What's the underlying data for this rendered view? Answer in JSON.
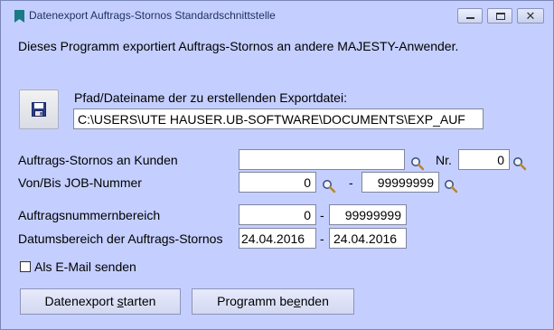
{
  "window": {
    "title": "Datenexport Auftrags-Stornos Standardschnittstelle",
    "minimize_glyph": "",
    "close_glyph": "✕"
  },
  "intro_text": "Dieses Programm exportiert Auftrags-Stornos an andere MAJESTY-Anwender.",
  "export_file": {
    "label": "Pfad/Dateiname der zu erstellenden Exportdatei:",
    "value": "C:\\USERS\\UTE HAUSER.UB-SOFTWARE\\DOCUMENTS\\EXP_AUF"
  },
  "customer": {
    "label": "Auftrags-Stornos an Kunden",
    "value": "",
    "nr_label": "Nr.",
    "nr_value": "0"
  },
  "job": {
    "label": "Von/Bis JOB-Nummer",
    "from": "0",
    "separator": "-",
    "to": "99999999"
  },
  "order_range": {
    "label": "Auftragsnummernbereich",
    "from": "0",
    "separator": "-",
    "to": "99999999"
  },
  "date_range": {
    "label": "Datumsbereich der Auftrags-Stornos",
    "from": "24.04.2016",
    "separator": "-",
    "to": "24.04.2016"
  },
  "email_option": {
    "label": "Als E-Mail senden",
    "checked": false
  },
  "buttons": {
    "start_pre": "Datenexport ",
    "start_ul": "s",
    "start_post": "tarten",
    "end_pre": "Programm be",
    "end_ul": "e",
    "end_post": "nden"
  },
  "icons": {
    "title": "bookmark-icon",
    "save": "floppy-disk-icon",
    "search": "magnifier-icon"
  },
  "colors": {
    "window_bg": "#c4cfff",
    "title_text": "#1e2f5e"
  }
}
